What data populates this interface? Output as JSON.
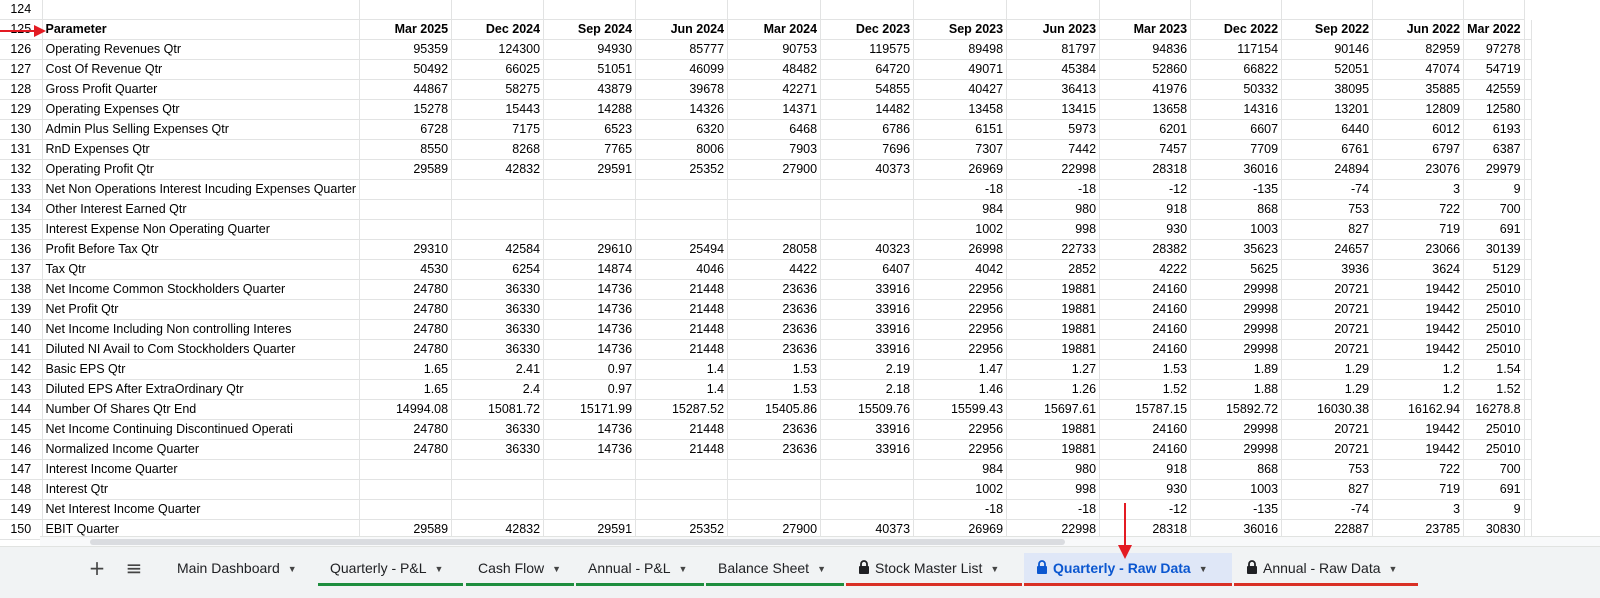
{
  "colors": {
    "accent_red": "#e31b23",
    "tab_green": "#1e8e3e",
    "tab_red": "#d93025",
    "active_blue": "#0b57d0"
  },
  "sheet": {
    "columns": [
      "Parameter",
      "Mar 2025",
      "Dec 2024",
      "Sep 2024",
      "Jun 2024",
      "Mar 2024",
      "Dec 2023",
      "Sep 2023",
      "Jun 2023",
      "Mar 2023",
      "Dec 2022",
      "Sep 2022",
      "Jun 2022",
      "Mar 2022"
    ],
    "first_row_number": "124",
    "header_row_number": "125",
    "rows": [
      {
        "n": "126",
        "cells": [
          "Operating Revenues Qtr",
          "95359",
          "124300",
          "94930",
          "85777",
          "90753",
          "119575",
          "89498",
          "81797",
          "94836",
          "117154",
          "90146",
          "82959",
          "97278"
        ]
      },
      {
        "n": "127",
        "cells": [
          "Cost Of Revenue Qtr",
          "50492",
          "66025",
          "51051",
          "46099",
          "48482",
          "64720",
          "49071",
          "45384",
          "52860",
          "66822",
          "52051",
          "47074",
          "54719"
        ]
      },
      {
        "n": "128",
        "cells": [
          "Gross Profit Quarter",
          "44867",
          "58275",
          "43879",
          "39678",
          "42271",
          "54855",
          "40427",
          "36413",
          "41976",
          "50332",
          "38095",
          "35885",
          "42559"
        ]
      },
      {
        "n": "129",
        "cells": [
          "Operating Expenses Qtr",
          "15278",
          "15443",
          "14288",
          "14326",
          "14371",
          "14482",
          "13458",
          "13415",
          "13658",
          "14316",
          "13201",
          "12809",
          "12580"
        ]
      },
      {
        "n": "130",
        "cells": [
          "Admin Plus Selling Expenses Qtr",
          "6728",
          "7175",
          "6523",
          "6320",
          "6468",
          "6786",
          "6151",
          "5973",
          "6201",
          "6607",
          "6440",
          "6012",
          "6193"
        ]
      },
      {
        "n": "131",
        "cells": [
          "RnD Expenses Qtr",
          "8550",
          "8268",
          "7765",
          "8006",
          "7903",
          "7696",
          "7307",
          "7442",
          "7457",
          "7709",
          "6761",
          "6797",
          "6387"
        ]
      },
      {
        "n": "132",
        "cells": [
          "Operating Profit Qtr",
          "29589",
          "42832",
          "29591",
          "25352",
          "27900",
          "40373",
          "26969",
          "22998",
          "28318",
          "36016",
          "24894",
          "23076",
          "29979"
        ]
      },
      {
        "n": "133",
        "cells": [
          "Net Non Operations Interest Incuding Expenses Quarter",
          "",
          "",
          "",
          "",
          "",
          "",
          "-18",
          "-18",
          "-12",
          "-135",
          "-74",
          "3",
          "9"
        ]
      },
      {
        "n": "134",
        "cells": [
          "Other Interest Earned Qtr",
          "",
          "",
          "",
          "",
          "",
          "",
          "984",
          "980",
          "918",
          "868",
          "753",
          "722",
          "700"
        ]
      },
      {
        "n": "135",
        "cells": [
          "Interest Expense Non Operating Quarter",
          "",
          "",
          "",
          "",
          "",
          "",
          "1002",
          "998",
          "930",
          "1003",
          "827",
          "719",
          "691"
        ]
      },
      {
        "n": "136",
        "cells": [
          "Profit Before Tax Qtr",
          "29310",
          "42584",
          "29610",
          "25494",
          "28058",
          "40323",
          "26998",
          "22733",
          "28382",
          "35623",
          "24657",
          "23066",
          "30139"
        ]
      },
      {
        "n": "137",
        "cells": [
          "Tax Qtr",
          "4530",
          "6254",
          "14874",
          "4046",
          "4422",
          "6407",
          "4042",
          "2852",
          "4222",
          "5625",
          "3936",
          "3624",
          "5129"
        ]
      },
      {
        "n": "138",
        "cells": [
          "Net Income Common Stockholders Quarter",
          "24780",
          "36330",
          "14736",
          "21448",
          "23636",
          "33916",
          "22956",
          "19881",
          "24160",
          "29998",
          "20721",
          "19442",
          "25010"
        ]
      },
      {
        "n": "139",
        "cells": [
          "Net Profit Qtr",
          "24780",
          "36330",
          "14736",
          "21448",
          "23636",
          "33916",
          "22956",
          "19881",
          "24160",
          "29998",
          "20721",
          "19442",
          "25010"
        ]
      },
      {
        "n": "140",
        "cells": [
          "Net Income Including Non controlling Interes",
          "24780",
          "36330",
          "14736",
          "21448",
          "23636",
          "33916",
          "22956",
          "19881",
          "24160",
          "29998",
          "20721",
          "19442",
          "25010"
        ]
      },
      {
        "n": "141",
        "cells": [
          "Diluted NI Avail to Com Stockholders Quarter",
          "24780",
          "36330",
          "14736",
          "21448",
          "23636",
          "33916",
          "22956",
          "19881",
          "24160",
          "29998",
          "20721",
          "19442",
          "25010"
        ]
      },
      {
        "n": "142",
        "cells": [
          "Basic EPS Qtr",
          "1.65",
          "2.41",
          "0.97",
          "1.4",
          "1.53",
          "2.19",
          "1.47",
          "1.27",
          "1.53",
          "1.89",
          "1.29",
          "1.2",
          "1.54"
        ]
      },
      {
        "n": "143",
        "cells": [
          "Diluted EPS After ExtraOrdinary Qtr",
          "1.65",
          "2.4",
          "0.97",
          "1.4",
          "1.53",
          "2.18",
          "1.46",
          "1.26",
          "1.52",
          "1.88",
          "1.29",
          "1.2",
          "1.52"
        ]
      },
      {
        "n": "144",
        "cells": [
          "Number Of Shares Qtr End",
          "14994.08",
          "15081.72",
          "15171.99",
          "15287.52",
          "15405.86",
          "15509.76",
          "15599.43",
          "15697.61",
          "15787.15",
          "15892.72",
          "16030.38",
          "16162.94",
          "16278.8"
        ]
      },
      {
        "n": "145",
        "cells": [
          "Net Income Continuing Discontinued Operati",
          "24780",
          "36330",
          "14736",
          "21448",
          "23636",
          "33916",
          "22956",
          "19881",
          "24160",
          "29998",
          "20721",
          "19442",
          "25010"
        ]
      },
      {
        "n": "146",
        "cells": [
          "Normalized Income Quarter",
          "24780",
          "36330",
          "14736",
          "21448",
          "23636",
          "33916",
          "22956",
          "19881",
          "24160",
          "29998",
          "20721",
          "19442",
          "25010"
        ]
      },
      {
        "n": "147",
        "cells": [
          "Interest Income Quarter",
          "",
          "",
          "",
          "",
          "",
          "",
          "984",
          "980",
          "918",
          "868",
          "753",
          "722",
          "700"
        ]
      },
      {
        "n": "148",
        "cells": [
          "Interest Qtr",
          "",
          "",
          "",
          "",
          "",
          "",
          "1002",
          "998",
          "930",
          "1003",
          "827",
          "719",
          "691"
        ]
      },
      {
        "n": "149",
        "cells": [
          "Net Interest Income Quarter",
          "",
          "",
          "",
          "",
          "",
          "",
          "-18",
          "-18",
          "-12",
          "-135",
          "-74",
          "3",
          "9"
        ]
      },
      {
        "n": "150",
        "cells": [
          "EBIT Quarter",
          "29589",
          "42832",
          "29591",
          "25352",
          "27900",
          "40373",
          "26969",
          "22998",
          "28318",
          "36016",
          "22887",
          "23785",
          "30830"
        ]
      }
    ]
  },
  "toolbar": {
    "add_icon": "plus-icon",
    "menu_icon": "hamburger-icon"
  },
  "tabs": [
    {
      "label": "Main Dashboard",
      "underline": "",
      "lock": false,
      "active": false
    },
    {
      "label": "Quarterly - P&L",
      "underline": "#1e8e3e",
      "lock": false,
      "active": false
    },
    {
      "label": "Cash Flow",
      "underline": "#1e8e3e",
      "lock": false,
      "active": false
    },
    {
      "label": "Annual - P&L",
      "underline": "#1e8e3e",
      "lock": false,
      "active": false
    },
    {
      "label": "Balance Sheet",
      "underline": "#1e8e3e",
      "lock": false,
      "active": false
    },
    {
      "label": "Stock Master List",
      "underline": "#d93025",
      "lock": true,
      "active": false
    },
    {
      "label": "Quarterly - Raw Data",
      "underline": "#d93025",
      "lock": true,
      "active": true
    },
    {
      "label": "Annual - Raw Data",
      "underline": "#d93025",
      "lock": true,
      "active": false
    }
  ]
}
